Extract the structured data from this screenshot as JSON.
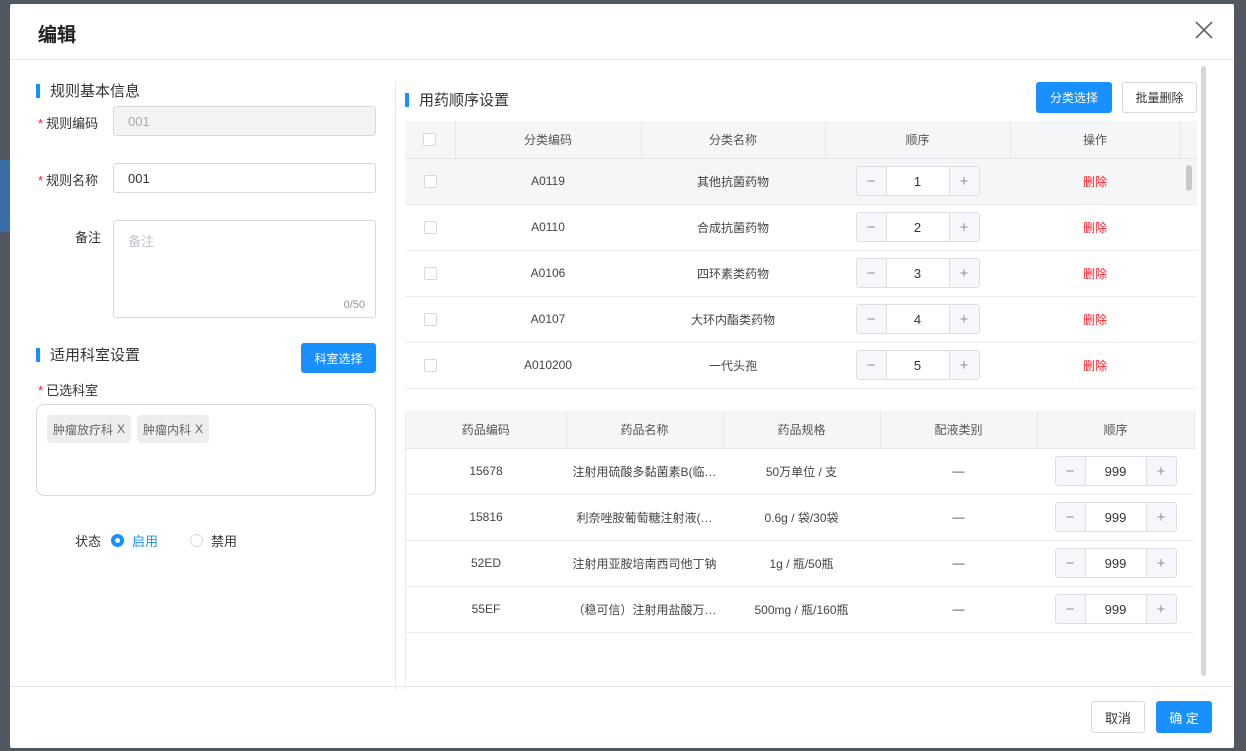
{
  "dialog": {
    "title": "编辑",
    "cancel_label": "取消",
    "confirm_label": "确 定"
  },
  "basic": {
    "section_title": "规则基本信息",
    "code_label": "规则编码",
    "code_value": "001",
    "name_label": "规则名称",
    "name_value": "001",
    "remark_label": "备注",
    "remark_placeholder": "备注",
    "remark_counter": "0/50"
  },
  "dept": {
    "section_title": "适用科室设置",
    "select_button": "科室选择",
    "selected_label": "已选科室",
    "tags": [
      {
        "label": "肿瘤放疗科",
        "remove": "X"
      },
      {
        "label": "肿瘤内科",
        "remove": "X"
      }
    ],
    "status_label": "状态",
    "status_options": [
      {
        "label": "启用",
        "checked": true
      },
      {
        "label": "禁用",
        "checked": false
      }
    ]
  },
  "order": {
    "section_title": "用药顺序设置",
    "category_button": "分类选择",
    "batch_delete_button": "批量删除",
    "columns": [
      "分类编码",
      "分类名称",
      "顺序",
      "操作"
    ],
    "rows": [
      {
        "code": "A0119",
        "name": "其他抗菌药物",
        "order": "1",
        "action": "删除"
      },
      {
        "code": "A0110",
        "name": "合成抗菌药物",
        "order": "2",
        "action": "删除"
      },
      {
        "code": "A0106",
        "name": "四环素类药物",
        "order": "3",
        "action": "删除"
      },
      {
        "code": "A0107",
        "name": "大环内酯类药物",
        "order": "4",
        "action": "删除"
      },
      {
        "code": "A010200",
        "name": "一代头孢",
        "order": "5",
        "action": "删除"
      }
    ]
  },
  "drugs": {
    "columns": [
      "药品编码",
      "药品名称",
      "药品规格",
      "配液类别",
      "顺序"
    ],
    "rows": [
      {
        "code": "15678",
        "name": "注射用硫酸多黏菌素B(临…",
        "spec": "50万单位 / 支",
        "type": "—",
        "order": "999"
      },
      {
        "code": "15816",
        "name": "利奈唑胺葡萄糖注射液(…",
        "spec": "0.6g / 袋/30袋",
        "type": "—",
        "order": "999"
      },
      {
        "code": "52ED",
        "name": "注射用亚胺培南西司他丁钠",
        "spec": "1g / 瓶/50瓶",
        "type": "—",
        "order": "999"
      },
      {
        "code": "55EF",
        "name": "（稳可信）注射用盐酸万…",
        "spec": "500mg / 瓶/160瓶",
        "type": "—",
        "order": "999"
      }
    ]
  },
  "stepper": {
    "minus": "−",
    "plus": "+"
  },
  "icons": [
    "close-icon"
  ],
  "colors": {
    "accent": "#1890ff",
    "danger": "#f5222d"
  }
}
